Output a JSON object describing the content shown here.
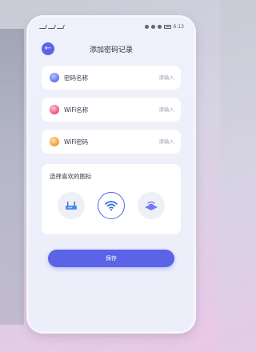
{
  "status_bar": {
    "left_text": "",
    "time": "6:13"
  },
  "header": {
    "title": "添加密码记录",
    "back_icon": "arrow-left-icon"
  },
  "form": {
    "fields": [
      {
        "label": "密码名称",
        "placeholder": "请输入",
        "icon": "globe-icon",
        "icon_color": "#6f7cf0"
      },
      {
        "label": "WiFi名称",
        "placeholder": "请输入",
        "icon": "candy-icon",
        "icon_color": "#f0608a"
      },
      {
        "label": "WiFi密码",
        "placeholder": "请输入",
        "icon": "orange-icon",
        "icon_color": "#f5a341"
      }
    ]
  },
  "icon_picker": {
    "title": "选择喜欢的图标",
    "options": [
      {
        "icon": "router-icon",
        "selected": false
      },
      {
        "icon": "wifi-icon",
        "selected": true
      },
      {
        "icon": "wifi-router-icon",
        "selected": false
      }
    ]
  },
  "actions": {
    "save_label": "保存"
  },
  "colors": {
    "accent": "#5b63e6",
    "card": "#ffffff",
    "background": "#eef0fb"
  }
}
